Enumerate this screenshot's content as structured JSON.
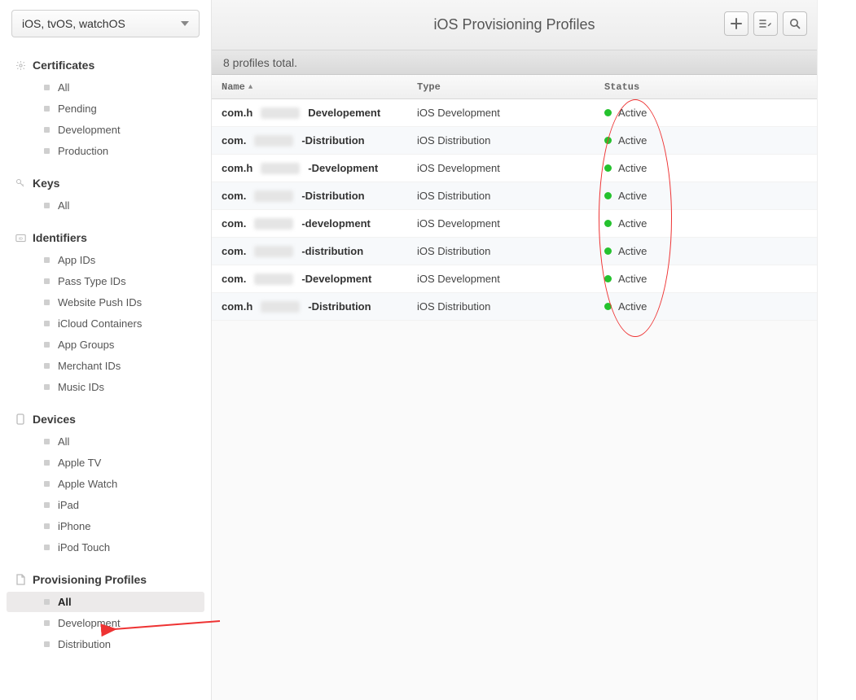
{
  "platform_selector": {
    "label": "iOS, tvOS, watchOS"
  },
  "sidebar": {
    "sections": [
      {
        "title": "Certificates",
        "icon": "gear",
        "items": [
          {
            "label": "All"
          },
          {
            "label": "Pending"
          },
          {
            "label": "Development"
          },
          {
            "label": "Production"
          }
        ]
      },
      {
        "title": "Keys",
        "icon": "key",
        "items": [
          {
            "label": "All"
          }
        ]
      },
      {
        "title": "Identifiers",
        "icon": "id",
        "items": [
          {
            "label": "App IDs"
          },
          {
            "label": "Pass Type IDs"
          },
          {
            "label": "Website Push IDs"
          },
          {
            "label": "iCloud Containers"
          },
          {
            "label": "App Groups"
          },
          {
            "label": "Merchant IDs"
          },
          {
            "label": "Music IDs"
          }
        ]
      },
      {
        "title": "Devices",
        "icon": "device",
        "items": [
          {
            "label": "All"
          },
          {
            "label": "Apple TV"
          },
          {
            "label": "Apple Watch"
          },
          {
            "label": "iPad"
          },
          {
            "label": "iPhone"
          },
          {
            "label": "iPod Touch"
          }
        ]
      },
      {
        "title": "Provisioning Profiles",
        "icon": "doc",
        "items": [
          {
            "label": "All",
            "selected": true
          },
          {
            "label": "Development"
          },
          {
            "label": "Distribution"
          }
        ]
      }
    ]
  },
  "page": {
    "title": "iOS Provisioning Profiles",
    "totals": "8 profiles total."
  },
  "table": {
    "headers": {
      "name": "Name",
      "type": "Type",
      "status": "Status"
    },
    "rows": [
      {
        "name_pre": "com.h",
        "name_post": "Developement",
        "type": "iOS Development",
        "status": "Active"
      },
      {
        "name_pre": "com.",
        "name_post": "-Distribution",
        "type": "iOS Distribution",
        "status": "Active"
      },
      {
        "name_pre": "com.h",
        "name_post": "-Development",
        "type": "iOS Development",
        "status": "Active"
      },
      {
        "name_pre": "com.",
        "name_post": "-Distribution",
        "type": "iOS Distribution",
        "status": "Active"
      },
      {
        "name_pre": "com.",
        "name_post": "-development",
        "type": "iOS Development",
        "status": "Active"
      },
      {
        "name_pre": "com.",
        "name_post": "-distribution",
        "type": "iOS Distribution",
        "status": "Active"
      },
      {
        "name_pre": "com.",
        "name_post": "-Development",
        "type": "iOS Development",
        "status": "Active"
      },
      {
        "name_pre": "com.h",
        "name_post": "-Distribution",
        "type": "iOS Distribution",
        "status": "Active"
      }
    ]
  }
}
